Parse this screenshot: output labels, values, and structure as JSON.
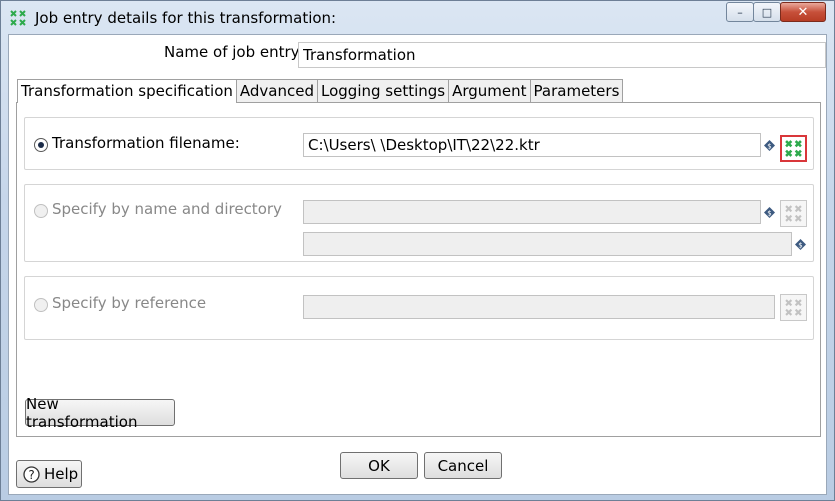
{
  "window": {
    "title": "Job entry details for this transformation:",
    "controls": {
      "minimize": "–",
      "maximize": "□",
      "close": "✕"
    }
  },
  "name_of_job_entry": {
    "label": "Name of job entry:",
    "value": "Transformation"
  },
  "tabs": [
    {
      "label": "Transformation specification",
      "active": true
    },
    {
      "label": "Advanced",
      "active": false
    },
    {
      "label": "Logging settings",
      "active": false
    },
    {
      "label": "Argument",
      "active": false
    },
    {
      "label": "Parameters",
      "active": false
    }
  ],
  "spec": {
    "filename_option": {
      "label": "Transformation filename:",
      "checked": true,
      "value": "C:\\Users\\            \\Desktop\\IT\\22\\22.ktr"
    },
    "name_dir_option": {
      "label": "Specify by name and directory",
      "checked": false,
      "name_value": "",
      "dir_value": ""
    },
    "reference_option": {
      "label": "Specify by reference",
      "checked": false,
      "value": ""
    }
  },
  "buttons": {
    "new_transformation": "New transformation",
    "ok": "OK",
    "cancel": "Cancel",
    "help": "Help"
  },
  "colors": {
    "highlight_border": "#d9363a",
    "kettle_green": "#2eaa4c"
  }
}
